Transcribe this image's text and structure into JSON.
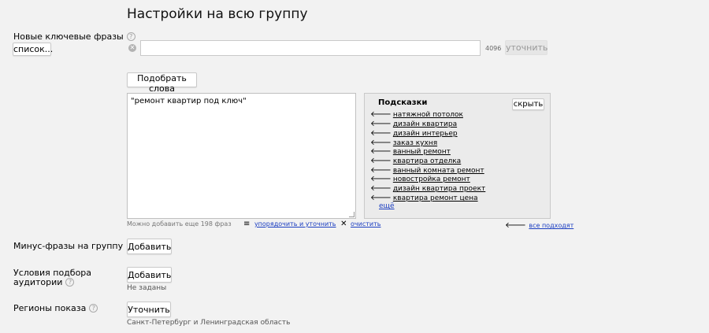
{
  "page": {
    "title": "Настройки на всю группу"
  },
  "keywords": {
    "label": "Новые ключевые фразы",
    "list_button": "список...",
    "input_value": "",
    "counter": "4096",
    "refine_button": "уточнить",
    "pick_words_button": "Подобрать слова",
    "phrases_text": "\"ремонт квартир под ключ\"",
    "remaining_text": "Можно добавить еще 198 фраз",
    "sort_refine_link": "упорядочить и уточнить",
    "clear_link": "очистить"
  },
  "suggestions": {
    "title": "Подсказки",
    "hide_button": "скрыть",
    "items": [
      "натяжной потолок",
      "дизайн квартира",
      "дизайн интерьер",
      "заказ кухня",
      "ванный ремонт",
      "квартира отделка",
      "ванный комната ремонт",
      "новостройка ремонт",
      "дизайн квартира проект",
      "квартира ремонт цена"
    ],
    "more_link": "ещё",
    "all_suitable_link": "все подходят"
  },
  "minus": {
    "label": "Минус-фразы на группу",
    "add_button": "Добавить"
  },
  "audience": {
    "label_line1": "Условия подбора",
    "label_line2": "аудитории",
    "add_button": "Добавить",
    "status": "Не заданы"
  },
  "regions": {
    "label": "Регионы показа",
    "refine_button": "Уточнить",
    "value": "Санкт-Петербург и Ленинградская область"
  }
}
